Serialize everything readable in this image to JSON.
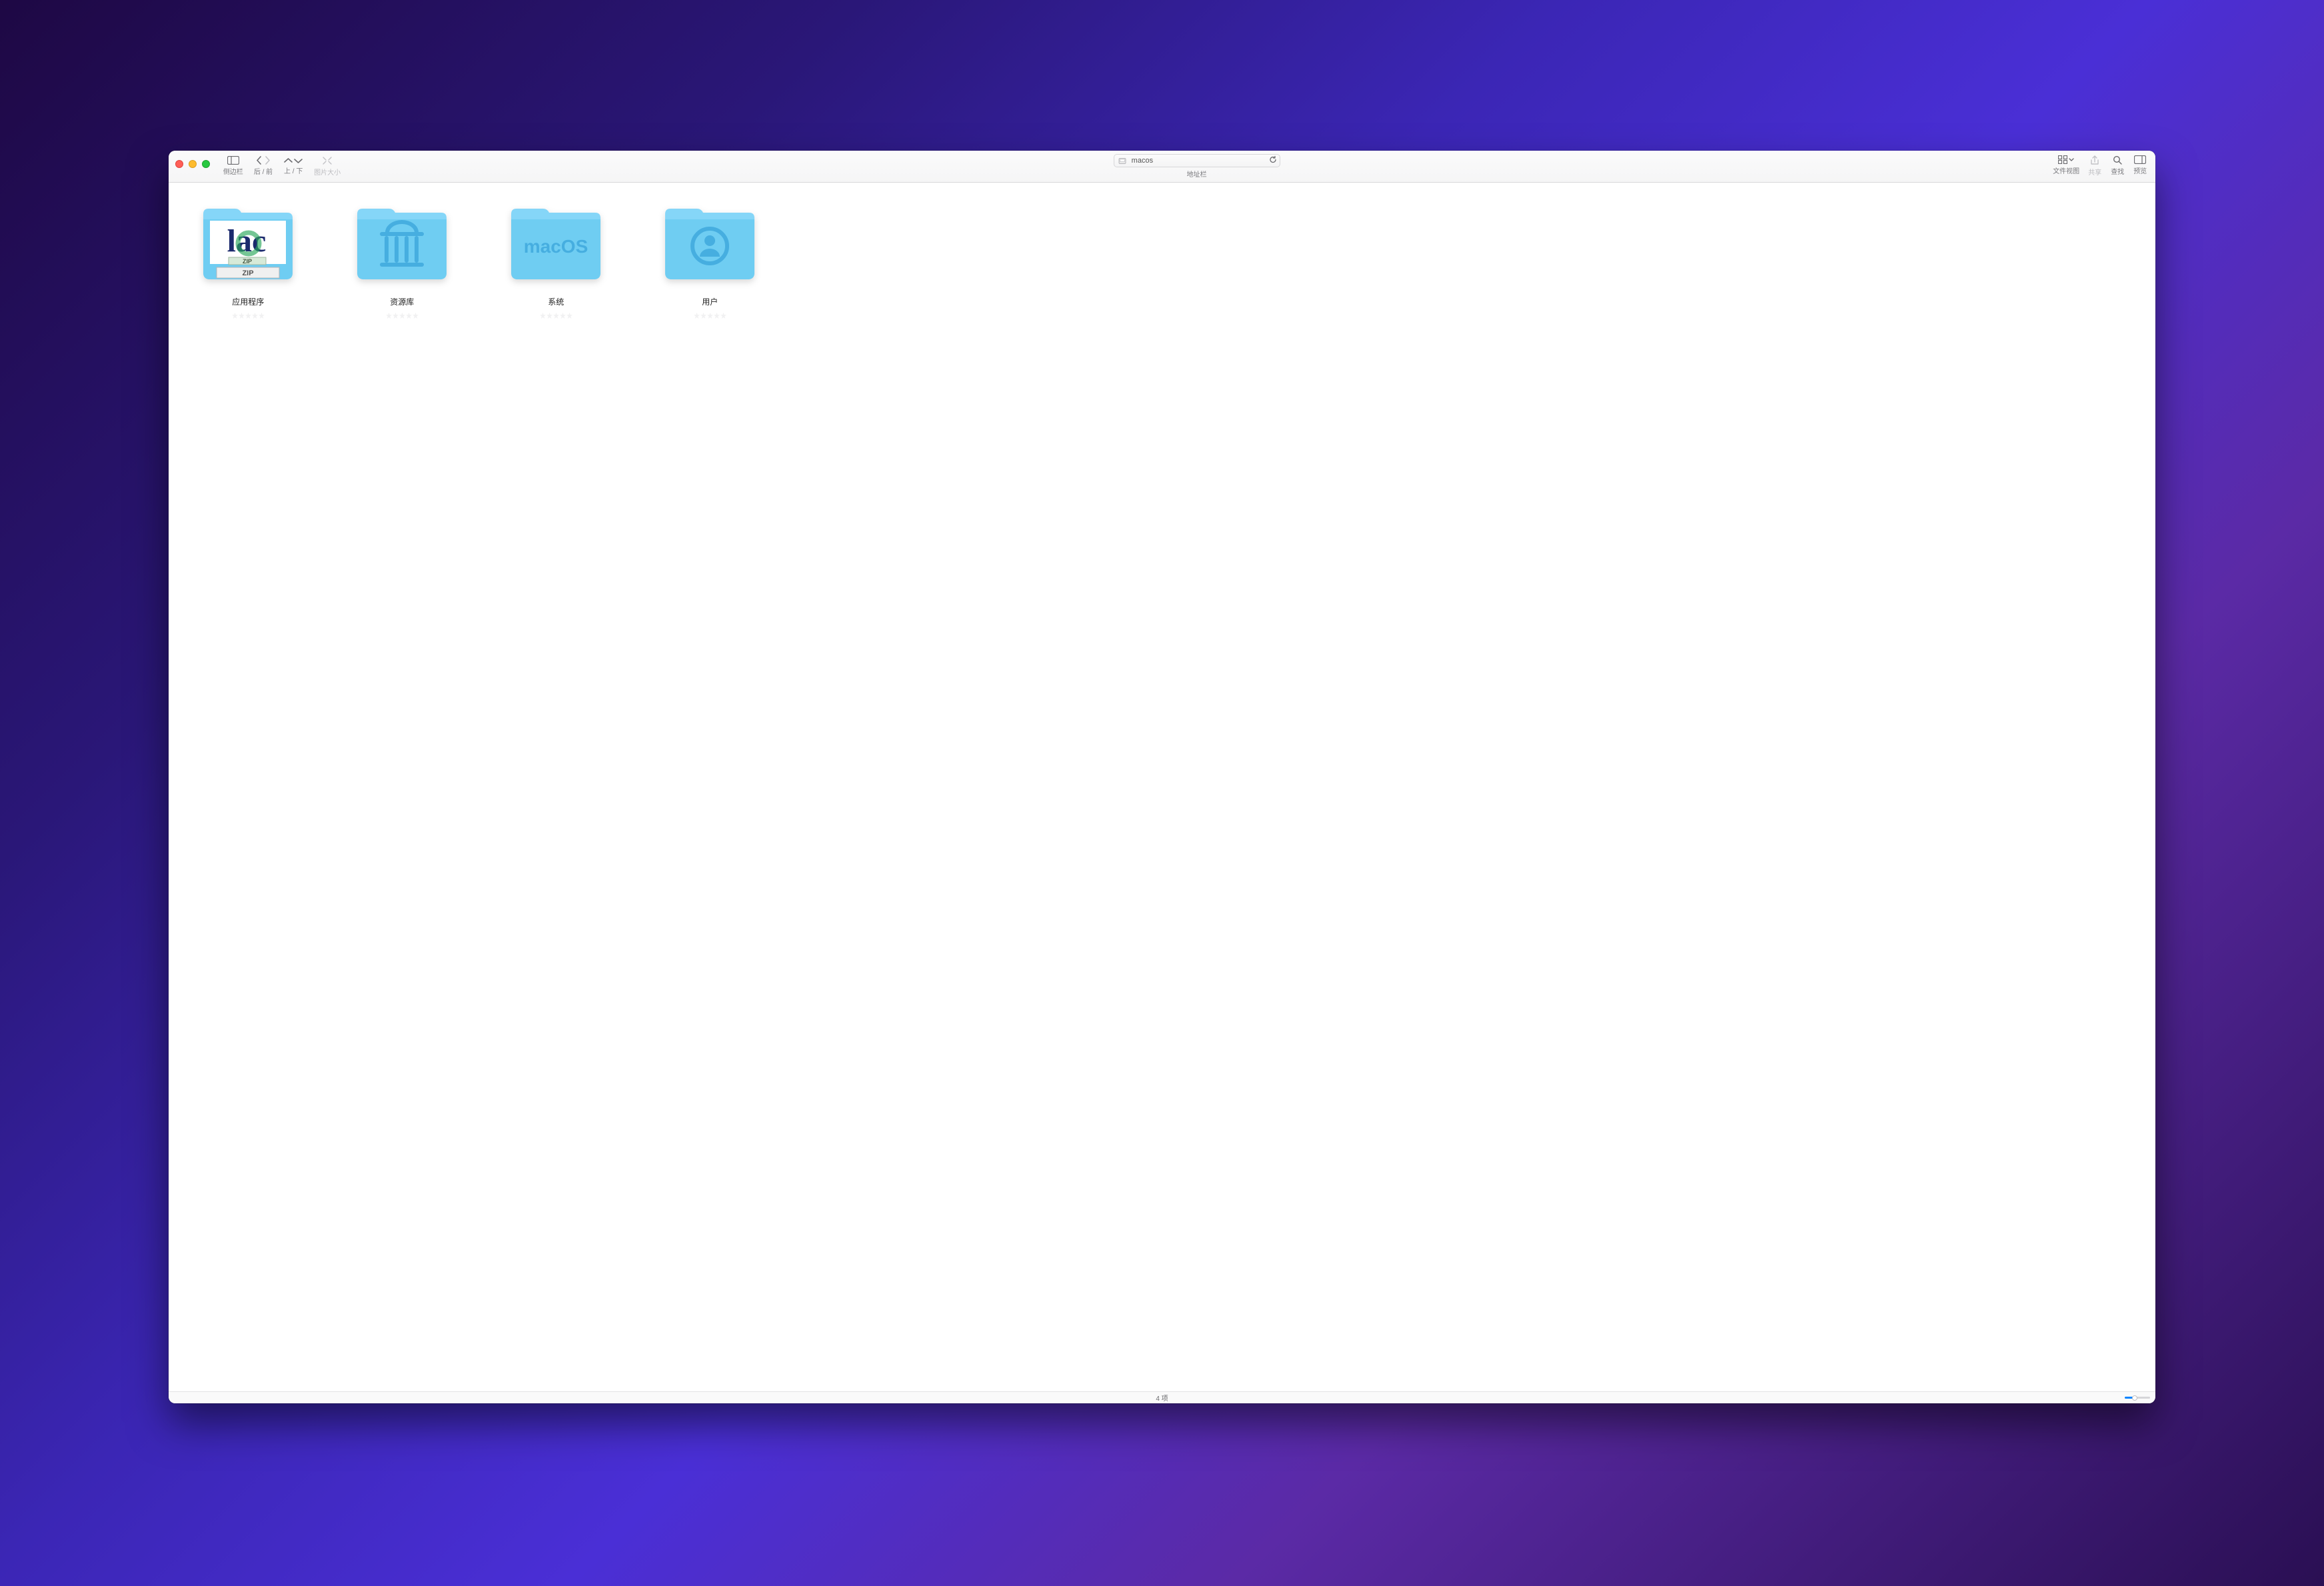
{
  "toolbar": {
    "sidebar_label": "侧边栏",
    "back_forward_label": "后 / 前",
    "up_down_label": "上 / 下",
    "image_size_label": "图片大小",
    "path_label": "地址栏",
    "path_value": "macos",
    "view_label": "文件视图",
    "share_label": "共享",
    "search_label": "查找",
    "preview_label": "预览"
  },
  "items": [
    {
      "name": "应用程序",
      "iconText": "lac",
      "zip": "ZIP",
      "zip2": "ZIP"
    },
    {
      "name": "资源库"
    },
    {
      "name": "系统",
      "badge": "macOS"
    },
    {
      "name": "用户"
    }
  ],
  "statusbar": {
    "count_text": "4 项"
  },
  "colors": {
    "folder_light": "#85d6f8",
    "folder_dark": "#60c5ee",
    "folder_tab": "#66c7ef"
  }
}
